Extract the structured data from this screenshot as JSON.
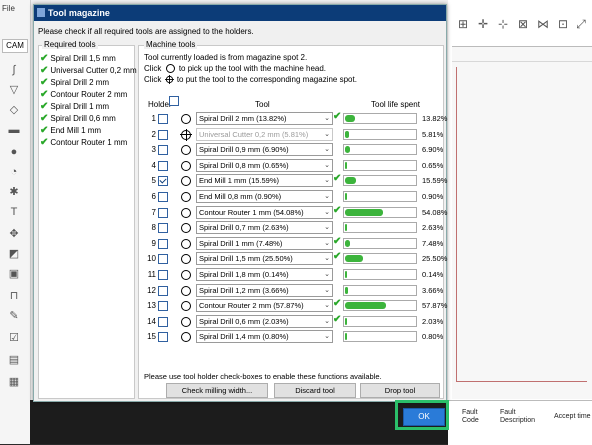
{
  "app": {
    "menu_file": "File",
    "cam_tab": "CAM",
    "fault_headers": [
      "Fault Code",
      "Fault Description",
      "Accept time"
    ]
  },
  "dialog": {
    "title": "Tool magazine",
    "hint": "Please check if all required tools are assigned to the holders.",
    "required_title": "Required tools",
    "required_tools": [
      "Spiral Drill  1,5 mm",
      "Universal Cutter 0,2 mm",
      "Spiral Drill  2 mm",
      "Contour Router 2 mm",
      "Spiral Drill  1 mm",
      "Spiral Drill  0,6 mm",
      "End Mill 1 mm",
      "Contour Router 1 mm"
    ],
    "machine_title": "Machine tools",
    "machine_info1": "Tool currently loaded is from magazine spot 2.",
    "machine_info2_pre": "Click",
    "machine_info2_post": "to pick up the tool with the machine head.",
    "machine_info3_pre": "Click",
    "machine_info3_post": "to put the tool to the corresponding magazine spot.",
    "col_holder": "Holder",
    "col_tool": "Tool",
    "col_life": "Tool life spent",
    "rows": [
      {
        "num": "1",
        "checked": false,
        "sym": "circle",
        "tool": "Spiral Drill   2 mm (13.82%)",
        "ok": true,
        "life": 13.82,
        "pct": "13.82%",
        "disabled": false
      },
      {
        "num": "2",
        "checked": false,
        "sym": "cross",
        "tool": "Universal Cutter 0,2 mm (5.81%)",
        "ok": false,
        "life": 5.81,
        "pct": "5.81%",
        "disabled": true
      },
      {
        "num": "3",
        "checked": false,
        "sym": "circle",
        "tool": "Spiral Drill   0,9 mm (6.90%)",
        "ok": false,
        "life": 6.9,
        "pct": "6.90%",
        "disabled": false
      },
      {
        "num": "4",
        "checked": false,
        "sym": "circle",
        "tool": "Spiral Drill   0,8 mm (0.65%)",
        "ok": false,
        "life": 0.65,
        "pct": "0.65%",
        "disabled": false
      },
      {
        "num": "5",
        "checked": true,
        "sym": "circle",
        "tool": "End Mill 1 mm (15.59%)",
        "ok": true,
        "life": 15.59,
        "pct": "15.59%",
        "disabled": false
      },
      {
        "num": "6",
        "checked": false,
        "sym": "circle",
        "tool": "End Mill 0,8 mm (0.90%)",
        "ok": false,
        "life": 0.9,
        "pct": "0.90%",
        "disabled": false
      },
      {
        "num": "7",
        "checked": false,
        "sym": "circle",
        "tool": "Contour Router 1 mm (54.08%)",
        "ok": true,
        "life": 54.08,
        "pct": "54.08%",
        "disabled": false
      },
      {
        "num": "8",
        "checked": false,
        "sym": "circle",
        "tool": "Spiral Drill   0,7 mm (2.63%)",
        "ok": false,
        "life": 2.63,
        "pct": "2.63%",
        "disabled": false
      },
      {
        "num": "9",
        "checked": false,
        "sym": "circle",
        "tool": "Spiral Drill   1 mm (7.48%)",
        "ok": true,
        "life": 7.48,
        "pct": "7.48%",
        "disabled": false
      },
      {
        "num": "10",
        "checked": false,
        "sym": "circle",
        "tool": "Spiral Drill   1,5 mm (25.50%)",
        "ok": true,
        "life": 25.5,
        "pct": "25.50%",
        "disabled": false
      },
      {
        "num": "11",
        "checked": false,
        "sym": "circle",
        "tool": "Spiral Drill   1,8 mm (0.14%)",
        "ok": false,
        "life": 0.14,
        "pct": "0.14%",
        "disabled": false
      },
      {
        "num": "12",
        "checked": false,
        "sym": "circle",
        "tool": "Spiral Drill   1,2 mm (3.66%)",
        "ok": false,
        "life": 3.66,
        "pct": "3.66%",
        "disabled": false
      },
      {
        "num": "13",
        "checked": false,
        "sym": "circle",
        "tool": "Contour Router 2 mm (57.87%)",
        "ok": true,
        "life": 57.87,
        "pct": "57.87%",
        "disabled": false
      },
      {
        "num": "14",
        "checked": false,
        "sym": "circle",
        "tool": "Spiral Drill   0,6 mm (2.03%)",
        "ok": true,
        "life": 2.03,
        "pct": "2.03%",
        "disabled": false
      },
      {
        "num": "15",
        "checked": false,
        "sym": "circle",
        "tool": "Spiral Drill   1,4 mm (0.80%)",
        "ok": false,
        "life": 0.8,
        "pct": "0.80%",
        "disabled": false
      }
    ],
    "notice": "Please use tool holder check-boxes to enable these functions available.",
    "btn_check": "Check milling width...",
    "btn_discard": "Discard tool",
    "btn_drop": "Drop tool",
    "btn_ok": "OK"
  },
  "colors": {
    "titlebar": "#0c3c78",
    "ok_button": "#2a7bd8",
    "highlight": "#2bbf6a",
    "life_fill": "#3cb43c"
  }
}
